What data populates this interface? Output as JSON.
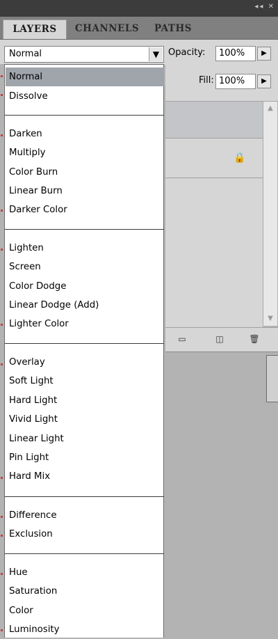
{
  "tabs": [
    {
      "label": "LAYERS"
    },
    {
      "label": "CHANNELS"
    },
    {
      "label": "PATHS"
    }
  ],
  "options": {
    "blend_mode_value": "Normal",
    "opacity_label": "Opacity:",
    "opacity_value": "100%",
    "fill_label": "Fill:",
    "fill_value": "100%"
  },
  "blend_modes": [
    {
      "label": "Normal",
      "selected": true
    },
    {
      "label": "Dissolve"
    },
    {
      "label": "Darken"
    },
    {
      "label": "Multiply"
    },
    {
      "label": "Color Burn"
    },
    {
      "label": "Linear Burn"
    },
    {
      "label": "Darker Color"
    },
    {
      "label": "Lighten"
    },
    {
      "label": "Screen"
    },
    {
      "label": "Color Dodge"
    },
    {
      "label": "Linear Dodge (Add)"
    },
    {
      "label": "Lighter Color"
    },
    {
      "label": "Overlay"
    },
    {
      "label": "Soft Light"
    },
    {
      "label": "Hard Light"
    },
    {
      "label": "Vivid Light"
    },
    {
      "label": "Linear Light"
    },
    {
      "label": "Pin Light"
    },
    {
      "label": "Hard Mix"
    },
    {
      "label": "Difference"
    },
    {
      "label": "Exclusion"
    },
    {
      "label": "Hue"
    },
    {
      "label": "Saturation"
    },
    {
      "label": "Color"
    },
    {
      "label": "Luminosity"
    }
  ],
  "icons": {
    "collapse": "double-arrow-icon",
    "close": "close-icon",
    "panel_menu": "panel-menu-icon",
    "dropdown_arrow": "chevron-down-icon",
    "flyout": "triangle-right-icon",
    "lock": "lock-icon",
    "new_group": "folder-icon",
    "new_layer": "new-layer-icon",
    "delete": "trash-icon"
  },
  "colors": {
    "selection": "#a0a4ab",
    "panel": "#d6d6d6",
    "tab_bar": "#808080",
    "title_bar": "#3c3c3c"
  }
}
